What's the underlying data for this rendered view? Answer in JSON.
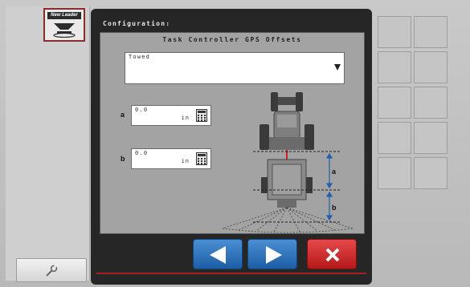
{
  "brand": {
    "logo_text": "New Leader"
  },
  "header": {
    "title": "Configuration:"
  },
  "panel": {
    "title": "Task Controller GPS Offsets",
    "hitch_type": {
      "value": "Towed"
    },
    "offset_a": {
      "letter": "a",
      "value": "0.0",
      "unit": "in"
    },
    "offset_b": {
      "letter": "b",
      "value": "0.0",
      "unit": "in"
    },
    "diagram": {
      "label_a": "a",
      "label_b": "b"
    }
  },
  "nav": {
    "back_icon": "left-arrow-icon",
    "forward_icon": "right-arrow-icon",
    "cancel_icon": "x-icon"
  },
  "sidebar": {
    "settings_icon": "wrench-icon"
  },
  "colors": {
    "accent_blue": "#2d74bf",
    "accent_red": "#c92424",
    "bezel": "#262626",
    "panel": "#a3a3a3"
  }
}
